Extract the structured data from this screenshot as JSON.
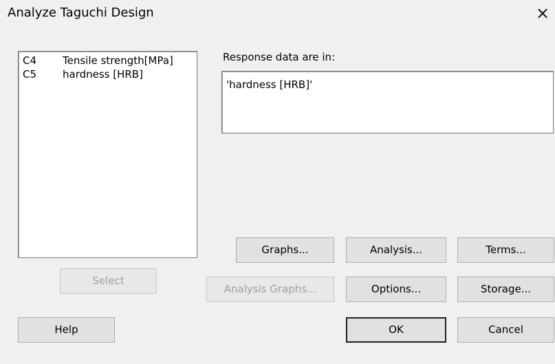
{
  "window": {
    "title": "Analyze Taguchi Design",
    "close_glyph": "×"
  },
  "variables": [
    {
      "col": "C4",
      "name": "Tensile strength[MPa]"
    },
    {
      "col": "C5",
      "name": "hardness [HRB]"
    }
  ],
  "response": {
    "label": "Response data are in:",
    "value": "'hardness [HRB]'"
  },
  "buttons": {
    "select": "Select",
    "help": "Help",
    "graphs": "Graphs...",
    "analysis": "Analysis...",
    "terms": "Terms...",
    "analysis_graphs": "Analysis Graphs...",
    "options": "Options...",
    "storage": "Storage...",
    "ok": "OK",
    "cancel": "Cancel"
  }
}
